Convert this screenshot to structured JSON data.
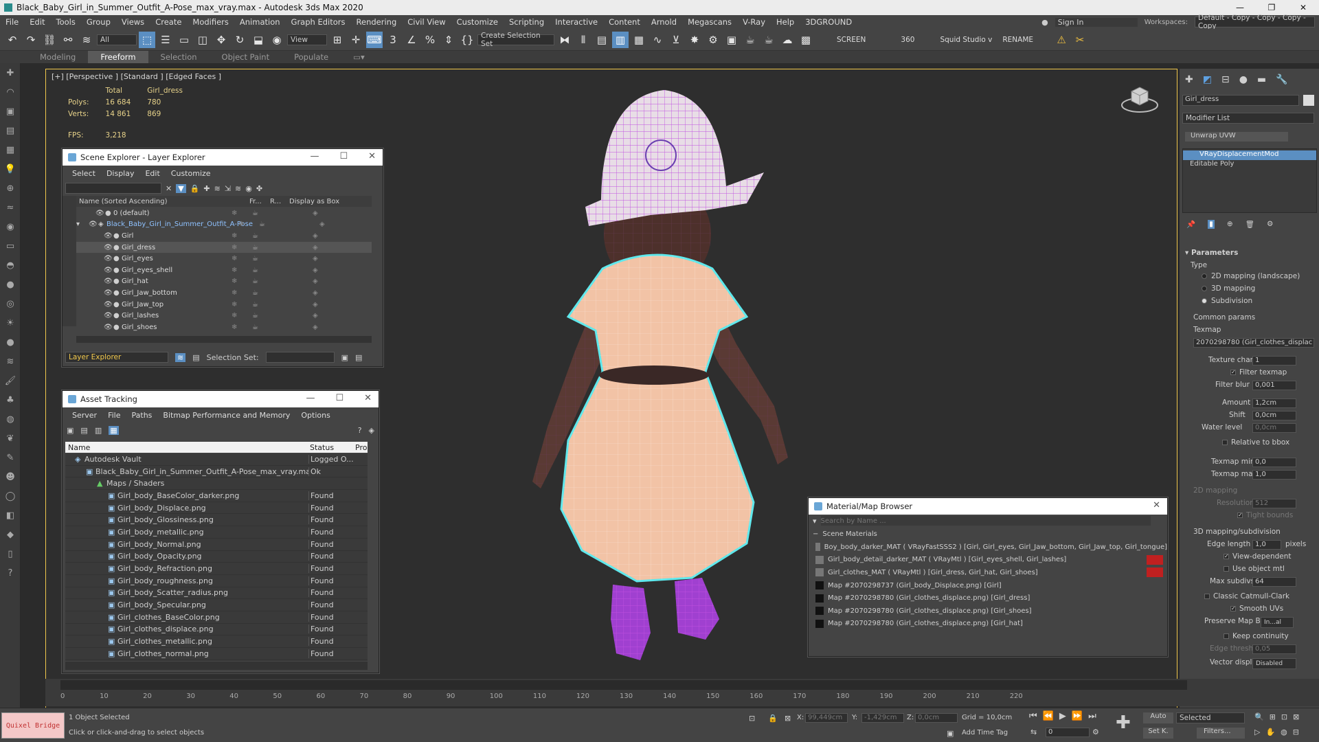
{
  "window": {
    "title": "Black_Baby_Girl_in_Summer_Outfit_A-Pose_max_vray.max - Autodesk 3ds Max 2020"
  },
  "menu": [
    "File",
    "Edit",
    "Tools",
    "Group",
    "Views",
    "Create",
    "Modifiers",
    "Animation",
    "Graph Editors",
    "Rendering",
    "Civil View",
    "Customize",
    "Scripting",
    "Interactive",
    "Content",
    "Arnold",
    "Megascans",
    "V-Ray",
    "Help",
    "3DGROUND"
  ],
  "signin": "Sign In",
  "workspaces_label": "Workspaces:",
  "workspace_value": "Default - Copy - Copy - Copy - Copy",
  "toolbar": {
    "filter": "All",
    "view": "View",
    "selection_set": "Create Selection Set",
    "screen": "SCREEN",
    "num360": "360",
    "squid": "Squid Studio v",
    "rename": "RENAME"
  },
  "ribbon": [
    "Modeling",
    "Freeform",
    "Selection",
    "Object Paint",
    "Populate"
  ],
  "viewport": {
    "label": "[+] [Perspective ] [Standard ] [Edged Faces ]",
    "stats": {
      "h_total": "Total",
      "h_obj": "Girl_dress",
      "polys_label": "Polys:",
      "polys_total": "16 684",
      "polys_obj": "780",
      "verts_label": "Verts:",
      "verts_total": "14 861",
      "verts_obj": "869",
      "fps_label": "FPS:",
      "fps": "3,218"
    }
  },
  "scene_explorer": {
    "title": "Scene Explorer - Layer Explorer",
    "menu": [
      "Select",
      "Display",
      "Edit",
      "Customize"
    ],
    "col_name": "Name (Sorted Ascending)",
    "col_fr": "Fr...",
    "col_r": "R...",
    "col_box": "Display as Box",
    "rows": [
      {
        "name": "0 (default)"
      },
      {
        "name": "Black_Baby_Girl_in_Summer_Outfit_A-Pose"
      },
      {
        "name": "Girl"
      },
      {
        "name": "Girl_dress"
      },
      {
        "name": "Girl_eyes"
      },
      {
        "name": "Girl_eyes_shell"
      },
      {
        "name": "Girl_hat"
      },
      {
        "name": "Girl_Jaw_bottom"
      },
      {
        "name": "Girl_Jaw_top"
      },
      {
        "name": "Girl_lashes"
      },
      {
        "name": "Girl_shoes"
      }
    ],
    "footer_dropdown": "Layer Explorer",
    "footer_selset": "Selection Set:"
  },
  "asset_tracking": {
    "title": "Asset Tracking",
    "menu": [
      "Server",
      "File",
      "Paths",
      "Bitmap Performance and Memory",
      "Options"
    ],
    "col_name": "Name",
    "col_status": "Status",
    "col_pro": "Pro",
    "rows": [
      {
        "name": "Autodesk Vault",
        "status": "Logged O..."
      },
      {
        "name": "Black_Baby_Girl_in_Summer_Outfit_A-Pose_max_vray.max",
        "status": "Ok"
      },
      {
        "name": "Maps / Shaders",
        "status": ""
      },
      {
        "name": "Girl_body_BaseColor_darker.png",
        "status": "Found"
      },
      {
        "name": "Girl_body_Displace.png",
        "status": "Found"
      },
      {
        "name": "Girl_body_Glossiness.png",
        "status": "Found"
      },
      {
        "name": "Girl_body_metallic.png",
        "status": "Found"
      },
      {
        "name": "Girl_body_Normal.png",
        "status": "Found"
      },
      {
        "name": "Girl_body_Opacity.png",
        "status": "Found"
      },
      {
        "name": "Girl_body_Refraction.png",
        "status": "Found"
      },
      {
        "name": "Girl_body_roughness.png",
        "status": "Found"
      },
      {
        "name": "Girl_body_Scatter_radius.png",
        "status": "Found"
      },
      {
        "name": "Girl_body_Specular.png",
        "status": "Found"
      },
      {
        "name": "Girl_clothes_BaseColor.png",
        "status": "Found"
      },
      {
        "name": "Girl_clothes_displace.png",
        "status": "Found"
      },
      {
        "name": "Girl_clothes_metallic.png",
        "status": "Found"
      },
      {
        "name": "Girl_clothes_normal.png",
        "status": "Found"
      }
    ]
  },
  "material_browser": {
    "title": "Material/Map Browser",
    "search_placeholder": "Search by Name ...",
    "section": "Scene Materials",
    "rows": [
      {
        "text": "Boy_body_darker_MAT  ( VRayFastSSS2 )  [Girl, Girl_eyes, Girl_Jaw_bottom, Girl_Jaw_top, Girl_tongue]"
      },
      {
        "text": "Girl_body_detail_darker_MAT  ( VRayMtl )  [Girl_eyes_shell, Girl_lashes]"
      },
      {
        "text": "Girl_clothes_MAT  ( VRayMtl )  [Girl_dress, Girl_hat, Girl_shoes]"
      },
      {
        "text": "Map #2070298737 (Girl_body_Displace.png)  [Girl]"
      },
      {
        "text": "Map #2070298780 (Girl_clothes_displace.png)  [Girl_dress]"
      },
      {
        "text": "Map #2070298780 (Girl_clothes_displace.png)  [Girl_shoes]"
      },
      {
        "text": "Map #2070298780 (Girl_clothes_displace.png)  [Girl_hat]"
      }
    ]
  },
  "modify_panel": {
    "object_name": "Girl_dress",
    "modifier_list": "Modifier List",
    "unwrap": "Unwrap UVW",
    "stack": [
      "VRayDisplacementMod",
      "Editable Poly"
    ],
    "rollout": "Parameters",
    "type_label": "Type",
    "types": [
      "2D mapping (landscape)",
      "3D mapping",
      "Subdivision"
    ],
    "common_params": "Common params",
    "texmap_label": "Texmap",
    "texmap_value": "2070298780 (Girl_clothes_displac",
    "texture_chan_label": "Texture chan",
    "texture_chan": "1",
    "filter_texmap": "Filter texmap",
    "filter_blur_label": "Filter blur",
    "filter_blur": "0,001",
    "amount_label": "Amount",
    "amount": "1,2cm",
    "shift_label": "Shift",
    "shift": "0,0cm",
    "water_label": "Water level",
    "water": "0,0cm",
    "relative_bbox": "Relative to bbox",
    "texmap_min_label": "Texmap min",
    "texmap_min": "0,0",
    "texmap_max_label": "Texmap max",
    "texmap_max": "1,0",
    "mapping2d": "2D mapping",
    "resolution_label": "Resolution",
    "resolution": "512",
    "tight_bounds": "Tight bounds",
    "mapping3d": "3D mapping/subdivision",
    "edge_length_label": "Edge length",
    "edge_length": "1,0",
    "pixels": "pixels",
    "view_dependent": "View-dependent",
    "use_object_mtl": "Use object mtl",
    "max_subdivs_label": "Max subdivs",
    "max_subdivs": "64",
    "classic_cc": "Classic Catmull-Clark",
    "smooth_uvs": "Smooth UVs",
    "preserve_label": "Preserve Map Bnd",
    "preserve": "In...al",
    "keep_continuity": "Keep continuity",
    "edge_thresh_label": "Edge thresh",
    "edge_thresh": "0,05",
    "vector_displ_label": "Vector displ",
    "vector_displ": "Disabled"
  },
  "timeline": {
    "ticks": [
      "0",
      "10",
      "20",
      "30",
      "40",
      "50",
      "60",
      "70",
      "80",
      "90",
      "100",
      "110",
      "120",
      "130",
      "140",
      "150",
      "160",
      "170",
      "180",
      "190",
      "200",
      "210",
      "220"
    ]
  },
  "status": {
    "objects_selected": "1 Object Selected",
    "hint": "Click or click-and-drag to select objects",
    "x_label": "X:",
    "x": "99,449cm",
    "y_label": "Y:",
    "y": "-1,429cm",
    "z_label": "Z:",
    "z": "0,0cm",
    "grid": "Grid = 10,0cm",
    "add_time_tag": "Add Time Tag",
    "auto": "Auto",
    "selected": "Selected",
    "setk": "Set K.",
    "filters": "Filters...",
    "frame": "0",
    "quixel": "Quixel Bridge"
  }
}
